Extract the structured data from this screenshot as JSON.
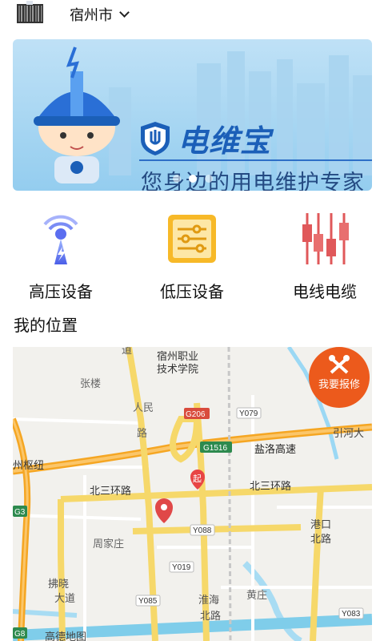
{
  "header": {
    "scan_icon": "barcode-scan-icon",
    "city": "宿州市",
    "city_icon": "chevron-down-icon"
  },
  "banner": {
    "title": "电维宝",
    "subtitle": "您身边的用电维护专家",
    "slides": 3,
    "active_slide": 2,
    "colors": {
      "sky": "#94cdef",
      "brand": "#1b5fb8"
    }
  },
  "categories": [
    {
      "label": "高压设备",
      "icon": "high-voltage-tower-icon"
    },
    {
      "label": "低压设备",
      "icon": "control-panel-icon"
    },
    {
      "label": "电线电缆",
      "icon": "cable-fuse-icon"
    }
  ],
  "location": {
    "title": "我的位置"
  },
  "map": {
    "repair_button": "我要报修",
    "labels": {
      "school_1": "宿州职业",
      "school_2": "技术学院",
      "zhanglou": "张楼",
      "renmin": "人民",
      "renmin2": "路",
      "g206": "G206",
      "y079": "Y079",
      "g1516": "G1516",
      "yanluo": "盐洛高速",
      "yinhe": "引河大",
      "hub": "州枢纽",
      "beisan_w": "北三环路",
      "beisan_e": "北三环路",
      "qi": "起",
      "g3": "G3",
      "y088": "Y088",
      "gangkou1": "港口",
      "gangkou2": "北路",
      "zhoujiazhuang": "周家庄",
      "y019": "Y019",
      "fuxiao1": "拂晓",
      "fuxiao2": "大道",
      "y085": "Y085",
      "huanghai1": "淮海",
      "huanghai2": "北路",
      "huangzhuang": "黄庄",
      "y083": "Y083",
      "g08": "G8",
      "dao": "道",
      "ganxian": "高速",
      "gaode": "高德地图"
    },
    "colors": {
      "road_main": "#f6d86a",
      "road_highway": "#f5a623",
      "water": "#8fd3f0",
      "pin": "#e84545",
      "repair": "#ec5a1c"
    }
  }
}
